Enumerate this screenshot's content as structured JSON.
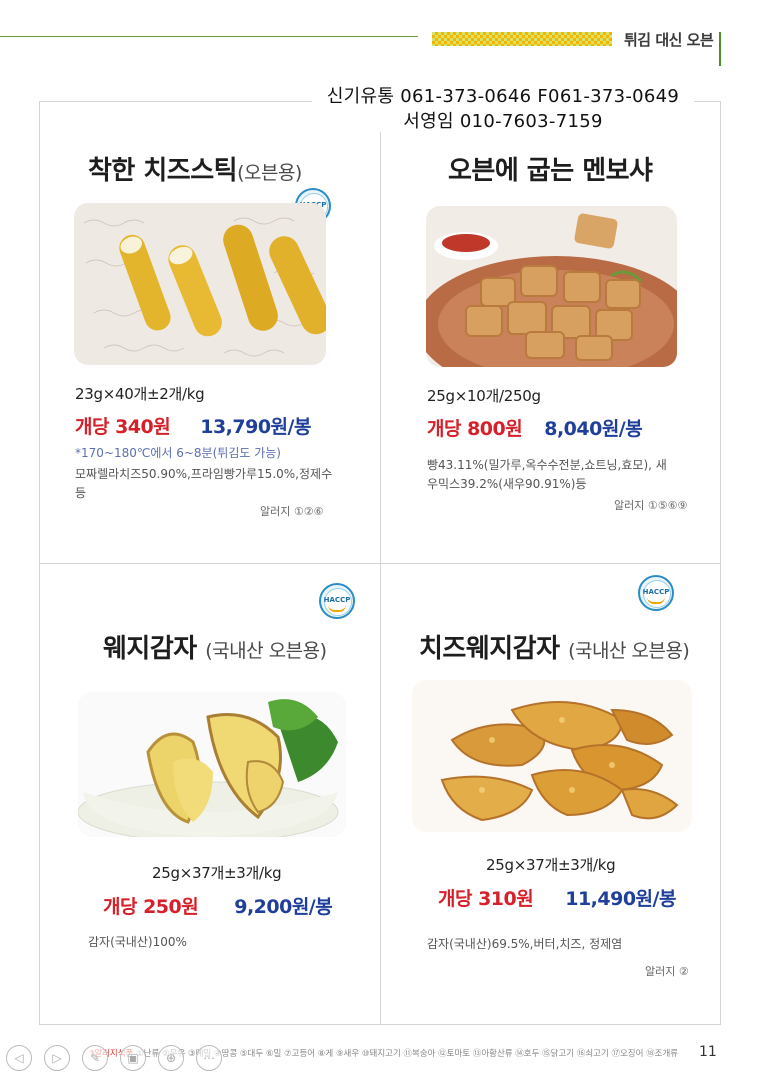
{
  "header": {
    "section_title": "튀김 대신 오븐"
  },
  "stamp": {
    "line1": "신기유통 061-373-0646 F061-373-0649",
    "line2": "서영임 010-7603-7159"
  },
  "products": [
    {
      "name": "착한  치즈스틱",
      "sub": "(오븐용)",
      "haccp": "HACCP",
      "spec": "23g×40개±2개/kg",
      "unit_price": "개당 340원",
      "pack_price": "13,790원/봉",
      "note": "*170~180℃에서  6~8분(튀김도 가능)",
      "ingredients": "모짜렐라치즈50.90%,프라임빵가루15.0%,정제수 등",
      "allergy": "알러지 ①②⑥"
    },
    {
      "name": "오븐에 굽는 멘보샤",
      "sub": "",
      "spec": "25g×10개/250g",
      "unit_price": "개당 800원",
      "pack_price": "8,040원/봉",
      "ingredients": "빵43.11%(밀가루,옥수수전분,쇼트닝,효모), 새우믹스39.2%(새우90.91%)등",
      "allergy": "알러지 ①⑤⑥⑨"
    },
    {
      "name": "웨지감자",
      "sub": "(국내산 오븐용)",
      "haccp": "HACCP",
      "spec": "25g×37개±3개/kg",
      "unit_price": "개당 250원",
      "pack_price": "9,200원/봉",
      "ingredients": "감자(국내산)100%"
    },
    {
      "name": "치즈웨지감자",
      "sub": "(국내산 오븐용)",
      "haccp": "HACCP",
      "spec": "25g×37개±3개/kg",
      "unit_price": "개당 310원",
      "pack_price": "11,490원/봉",
      "ingredients": "감자(국내산)69.5%,버터,치즈, 정제염",
      "allergy": "알러지 ②"
    }
  ],
  "footer": {
    "lead": "*알러지식품",
    "list": "①난류 ②우유 ③메밀 ④땅콩 ⑤대두 ⑥밀 ⑦고등어 ⑧게 ⑨새우 ⑩돼지고기 ⑪복숭아 ⑫토마토 ⑬아황산류 ⑭호두 ⑮닭고기 ⑯쇠고기 ⑰오징어 ⑱조개류",
    "page": "11"
  },
  "viewer": {
    "prev": "◁",
    "next": "▷",
    "pen": "✎",
    "pages": "▣",
    "zoom": "⊕",
    "more": "⋯"
  },
  "colors": {
    "unit_price": "#d6202a",
    "pack_price": "#1f3f9a",
    "accent_green": "#4f8a2b",
    "checker": "#f3b500"
  }
}
